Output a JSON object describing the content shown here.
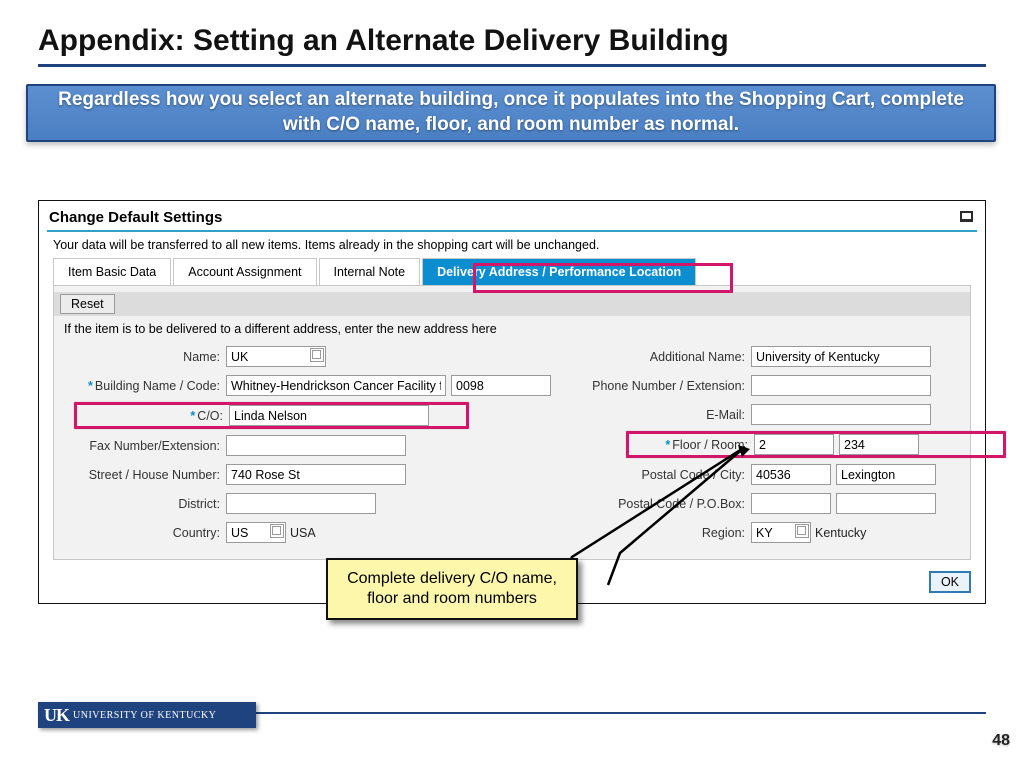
{
  "slide": {
    "title": "Appendix: Setting an Alternate Delivery Building",
    "banner": "Regardless how you select an alternate building, once it populates into the Shopping Cart, complete with C/O name, floor, and room number as normal."
  },
  "panel": {
    "title": "Change Default Settings",
    "note": "Your data will be transferred to all new items. Items already in the shopping cart will be unchanged."
  },
  "tabs": {
    "basic": "Item Basic Data",
    "account": "Account Assignment",
    "note": "Internal Note",
    "delivery": "Delivery Address / Performance Location"
  },
  "form": {
    "reset": "Reset",
    "note": "If the item is to be delivered to a different address, enter the new address here",
    "left": {
      "name_label": "Name:",
      "name": "UK",
      "bldg_label": "Building Name / Code:",
      "bldg_name": "Whitney-Hendrickson Cancer Facility for",
      "bldg_code": "0098",
      "co_label": "C/O:",
      "co": "Linda Nelson",
      "fax_label": "Fax Number/Extension:",
      "fax": "",
      "street_label": "Street / House Number:",
      "street": "740 Rose St",
      "district_label": "District:",
      "district": "",
      "country_label": "Country:",
      "country_code": "US",
      "country_name": "USA"
    },
    "right": {
      "addl_label": "Additional Name:",
      "addl": "University of Kentucky",
      "phone_label": "Phone Number / Extension:",
      "phone": "",
      "email_label": "E-Mail:",
      "email": "",
      "floor_label": "Floor / Room:",
      "floor": "2",
      "room": "234",
      "postal_city_label": "Postal Code / City:",
      "postal": "40536",
      "city": "Lexington",
      "pobox_label": "Postal Code / P.O.Box:",
      "po_postal": "",
      "po_box": "",
      "region_label": "Region:",
      "region_code": "KY",
      "region_name": "Kentucky"
    },
    "ok": "OK"
  },
  "callout": "Complete delivery C/O name, floor and room numbers",
  "footer": {
    "logo_mono": "UK",
    "logo_text": "UNIVERSITY OF KENTUCKY",
    "page": "48"
  }
}
